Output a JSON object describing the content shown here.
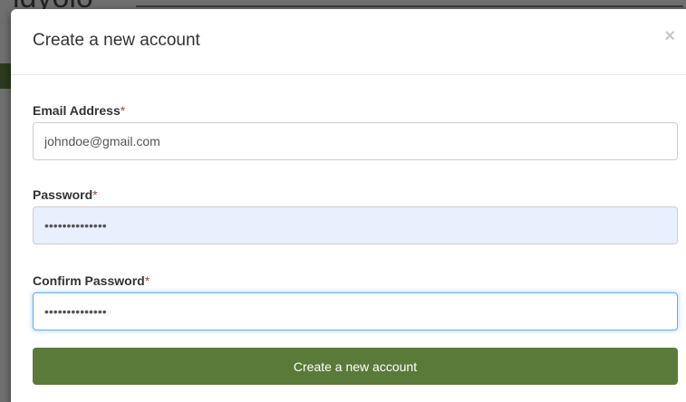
{
  "backdrop": {
    "partial_text": "ldyolo"
  },
  "modal": {
    "title": "Create a new account",
    "close_glyph": "×"
  },
  "form": {
    "email": {
      "label": "Email Address",
      "required_marker": "*",
      "value": "johndoe@gmail.com"
    },
    "password": {
      "label": "Password",
      "required_marker": "*",
      "value": "••••••••••••••"
    },
    "confirm_password": {
      "label": "Confirm Password",
      "required_marker": "*",
      "value": "••••••••••••••"
    },
    "submit_label": "Create a new account"
  },
  "colors": {
    "primary_button": "#5a7a3a",
    "required_star": "#a94442",
    "autofill_bg": "#e8f0fe",
    "focus_border": "#66afe9"
  },
  "icons": {
    "close": "close-icon"
  }
}
